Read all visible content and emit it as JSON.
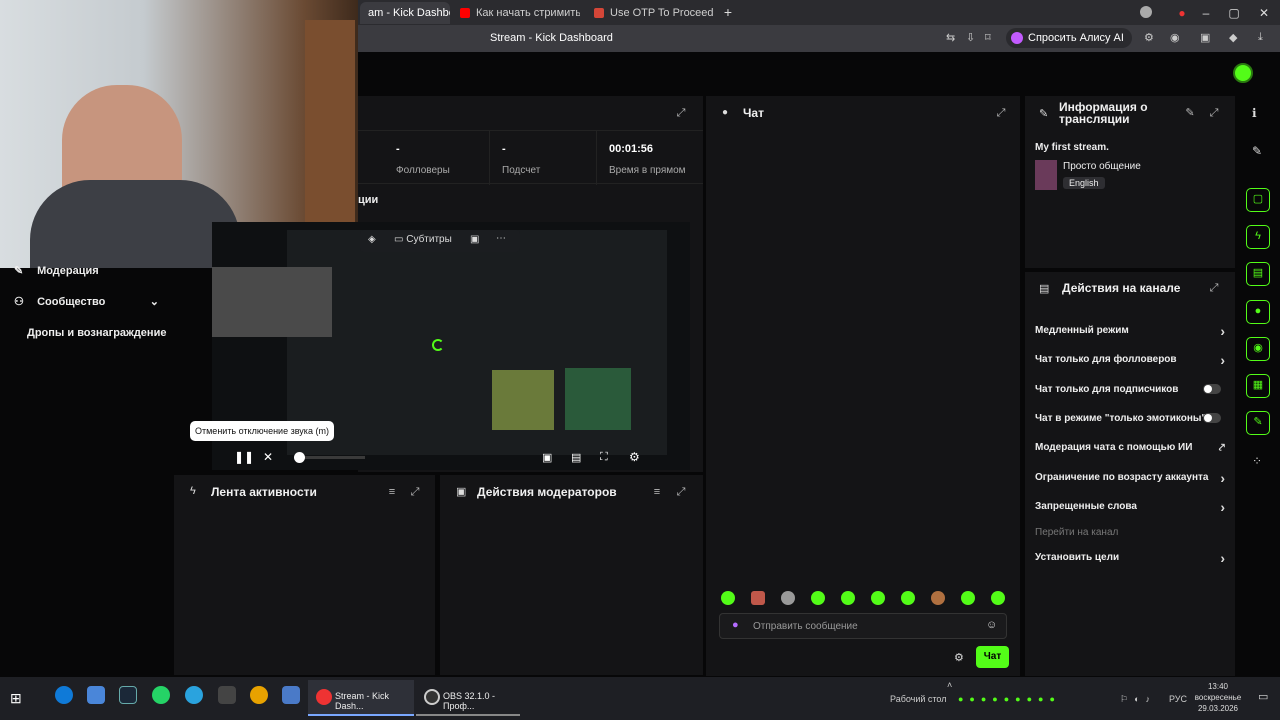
{
  "browser": {
    "tabs": [
      {
        "label": "am - Kick Dashboar",
        "active": true,
        "color": "#53fc18"
      },
      {
        "label": "Как начать стримить на Ки",
        "active": false,
        "color": "#ff0000"
      },
      {
        "label": "Use OTP To Proceed - clau",
        "active": false,
        "color": "#d44638"
      }
    ],
    "new_tab": "+",
    "page_title": "Stream - Kick Dashboard",
    "alice_button": "Спросить Алису AI"
  },
  "sidebar": {
    "items": [
      {
        "label": "Модерация"
      },
      {
        "label": "Сообщество"
      },
      {
        "label": "Дропы и вознаграждение"
      }
    ]
  },
  "stream_panel": {
    "stats": [
      {
        "value": "-",
        "label": "Фолловеры"
      },
      {
        "value": "-",
        "label": "Подсчет"
      },
      {
        "value": "00:01:56",
        "label": "Время в прямом"
      }
    ],
    "section_partial": "ции",
    "subtitles_label": "Субтитры",
    "tooltip": "Отменить отключение звука (m)"
  },
  "activity_feed": {
    "title": "Лента активности"
  },
  "mod_actions": {
    "title": "Действия модераторов"
  },
  "chat": {
    "title": "Чат",
    "placeholder": "Отправить сообщение",
    "send_label": "Чат"
  },
  "stream_info": {
    "title_line1": "Информация о",
    "title_line2": "трансляции",
    "stream_title": "My first stream.",
    "category": "Просто общение",
    "language": "English"
  },
  "channel_actions": {
    "title": "Действия на канале",
    "items": [
      {
        "label": "Медленный режим",
        "control": "chevron"
      },
      {
        "label": "Чат только для фолловеров",
        "control": "chevron"
      },
      {
        "label": "Чат только для подписчиков",
        "control": "toggle"
      },
      {
        "label": "Чат в режиме \"только эмотиконы\"",
        "control": "toggle"
      },
      {
        "label": "Модерация чата с помощью ИИ",
        "control": "external"
      },
      {
        "label": "Ограничение по возрасту аккаунта",
        "control": "chevron"
      },
      {
        "label": "Запрещенные слова",
        "control": "chevron"
      },
      {
        "label": "Перейти на канал",
        "control": "none"
      },
      {
        "label": "Установить цели",
        "control": "chevron"
      }
    ]
  },
  "taskbar": {
    "apps": [
      {
        "label": "Stream - Kick Dash..."
      },
      {
        "label": "OBS 32.1.0 - Проф..."
      }
    ],
    "desktop_label": "Рабочий стол",
    "lang": "РУС",
    "time": "13:40",
    "day": "воскресенье",
    "date": "29.03.2026"
  },
  "colors": {
    "accent": "#53fc18"
  }
}
